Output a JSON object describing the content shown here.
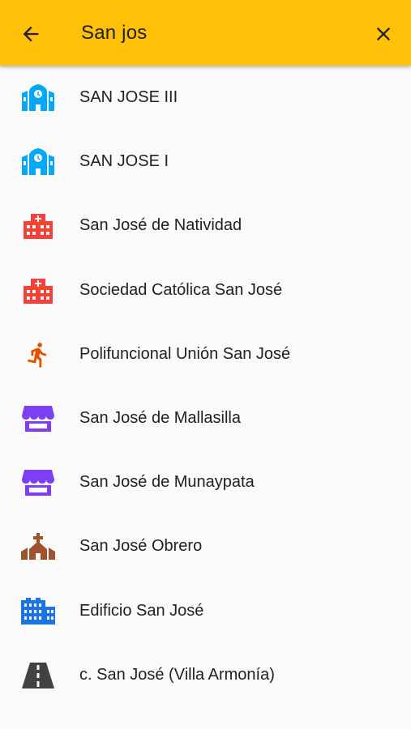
{
  "header": {
    "title": "San jos",
    "back_icon": "arrow-left-icon",
    "close_icon": "close-icon",
    "background_color": "#ffc107"
  },
  "results": [
    {
      "label": "SAN JOSE III",
      "icon": "school-icon",
      "color": "#03a9f4"
    },
    {
      "label": "SAN JOSE I",
      "icon": "school-icon",
      "color": "#03a9f4"
    },
    {
      "label": "San José de Natividad",
      "icon": "hospital-icon",
      "color": "#f44336"
    },
    {
      "label": "Sociedad Católica San José",
      "icon": "hospital-icon",
      "color": "#f44336"
    },
    {
      "label": "Polifuncional Unión San José",
      "icon": "sports-runner-icon",
      "color": "#e65100"
    },
    {
      "label": "San José de Mallasilla",
      "icon": "store-icon",
      "color": "#7e3ff2"
    },
    {
      "label": "San José de Munaypata",
      "icon": "store-icon",
      "color": "#7e3ff2"
    },
    {
      "label": "San José Obrero",
      "icon": "church-icon",
      "color": "#a0522d"
    },
    {
      "label": "Edificio San José",
      "icon": "building-icon",
      "color": "#1a73e8"
    },
    {
      "label": "c. San José (Villa Armonía)",
      "icon": "road-icon",
      "color": "#424242"
    }
  ]
}
